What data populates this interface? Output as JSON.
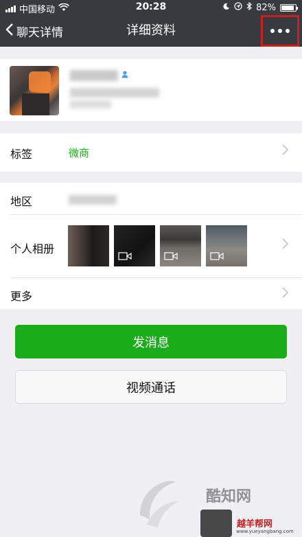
{
  "status_bar": {
    "carrier": "中国移动",
    "time": "20:28",
    "battery": "82%"
  },
  "nav": {
    "back_label": "聊天详情",
    "title": "详细资料"
  },
  "tags_row": {
    "label": "标签",
    "value": "微商"
  },
  "region_row": {
    "label": "地区"
  },
  "album_row": {
    "label": "个人相册"
  },
  "more_row": {
    "label": "更多"
  },
  "buttons": {
    "send_message": "发消息",
    "video_call": "视频通话"
  },
  "watermark": {
    "site1": "酷知网",
    "site2": "越羊帮网",
    "url": "www.yueyangbang.com"
  }
}
